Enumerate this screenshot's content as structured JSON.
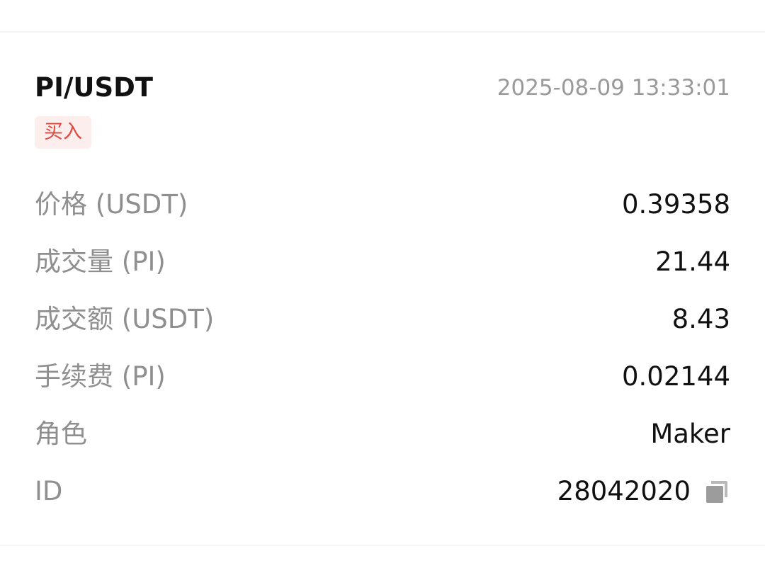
{
  "trade": {
    "pair": "PI/USDT",
    "time": "2025-08-09 13:33:01",
    "side": "买入",
    "side_color": "#e2473f",
    "rows": [
      {
        "label": "价格 (USDT)",
        "value": "0.39358"
      },
      {
        "label": "成交量 (PI)",
        "value": "21.44"
      },
      {
        "label": "成交额 (USDT)",
        "value": "8.43"
      },
      {
        "label": "手续费 (PI)",
        "value": "0.02144"
      },
      {
        "label": "角色",
        "value": "Maker"
      },
      {
        "label": "ID",
        "value": "28042020",
        "icon": "copy-icon"
      }
    ]
  }
}
